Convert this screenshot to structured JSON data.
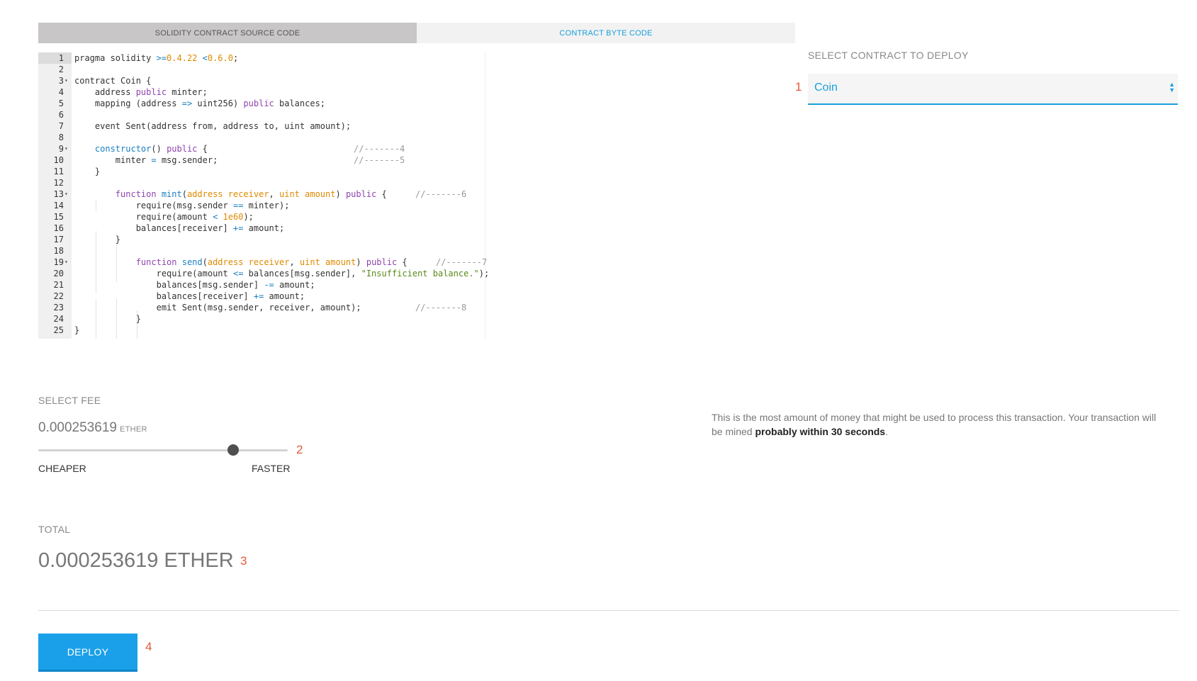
{
  "tabs": {
    "source": "SOLIDITY CONTRACT SOURCE CODE",
    "bytecode": "CONTRACT BYTE CODE"
  },
  "editor": {
    "line_numbers": [
      "1",
      "2",
      "3",
      "4",
      "5",
      "6",
      "7",
      "8",
      "9",
      "10",
      "11",
      "12",
      "13",
      "14",
      "15",
      "16",
      "17",
      "18",
      "19",
      "20",
      "21",
      "22",
      "23",
      "24",
      "25"
    ],
    "fold_icon": "▾",
    "code": {
      "l1_a": "pragma solidity ",
      "l1_op1": ">=",
      "l1_n1": "0.4.22",
      "l1_op2": " <",
      "l1_n2": "0.6.0",
      "l1_end": ";",
      "l3": "contract Coin {",
      "l4_a": "    address ",
      "l4_kw": "public",
      "l4_b": " minter;",
      "l5_a": "    mapping (address ",
      "l5_op": "=>",
      "l5_b": " uint256) ",
      "l5_kw": "public",
      "l5_c": " balances;",
      "l7": "    event Sent(address from, address to, uint amount);",
      "l9_fn": "    constructor",
      "l9_a": "() ",
      "l9_kw": "public",
      "l9_b": " {",
      "l9_cmt": "//-------4",
      "l10_a": "        minter ",
      "l10_op": "=",
      "l10_b": " msg.sender;",
      "l10_cmt": "//-------5",
      "l11": "    }",
      "l13_kw1": "        function",
      "l13_fn": " mint",
      "l13_a": "(",
      "l13_p1": "address receiver",
      "l13_b": ", ",
      "l13_p2": "uint amount",
      "l13_c": ") ",
      "l13_kw2": "public",
      "l13_d": " {",
      "l13_cmt": "//-------6",
      "l14_a": "            require(msg.sender ",
      "l14_op": "==",
      "l14_b": " minter);",
      "l15_a": "            require(amount ",
      "l15_op": "<",
      "l15_n": " 1e60",
      "l15_b": ");",
      "l16_a": "            balances[receiver] ",
      "l16_op": "+=",
      "l16_b": " amount;",
      "l17": "        }",
      "l19_kw1": "            function",
      "l19_fn": " send",
      "l19_a": "(",
      "l19_p1": "address receiver",
      "l19_b": ", ",
      "l19_p2": "uint amount",
      "l19_c": ") ",
      "l19_kw2": "public",
      "l19_d": " {",
      "l19_cmt": "//-------7",
      "l20_a": "                require(amount ",
      "l20_op": "<=",
      "l20_b": " balances[msg.sender], ",
      "l20_str": "\"Insufficient balance.\"",
      "l20_c": ");",
      "l21_a": "                balances[msg.sender] ",
      "l21_op": "-=",
      "l21_b": " amount;",
      "l22_a": "                balances[receiver] ",
      "l22_op": "+=",
      "l22_b": " amount;",
      "l23_a": "                emit Sent(msg.sender, receiver, amount);",
      "l23_cmt": "//-------8",
      "l24": "            }",
      "l25": "}"
    }
  },
  "contract_select": {
    "label": "SELECT CONTRACT TO DEPLOY",
    "value": "Coin",
    "arrows_icon": "▲▼"
  },
  "markers": {
    "m1": "1",
    "m2": "2",
    "m3": "3",
    "m4": "4"
  },
  "fee": {
    "label": "SELECT FEE",
    "value": "0.000253619",
    "unit": "ETHER",
    "slider_position": 0.78,
    "cheaper_label": "CHEAPER",
    "faster_label": "FASTER",
    "description_prefix": "This is the most amount of money that might be used to process this transaction. Your transaction will be mined ",
    "description_bold": "probably within 30 seconds",
    "description_suffix": "."
  },
  "total": {
    "label": "TOTAL",
    "value": "0.000253619 ETHER"
  },
  "deploy_button": {
    "label": "DEPLOY"
  },
  "colors": {
    "accent": "#1aa0dc",
    "marker": "#e35b3a",
    "button": "#1aa0e8"
  }
}
